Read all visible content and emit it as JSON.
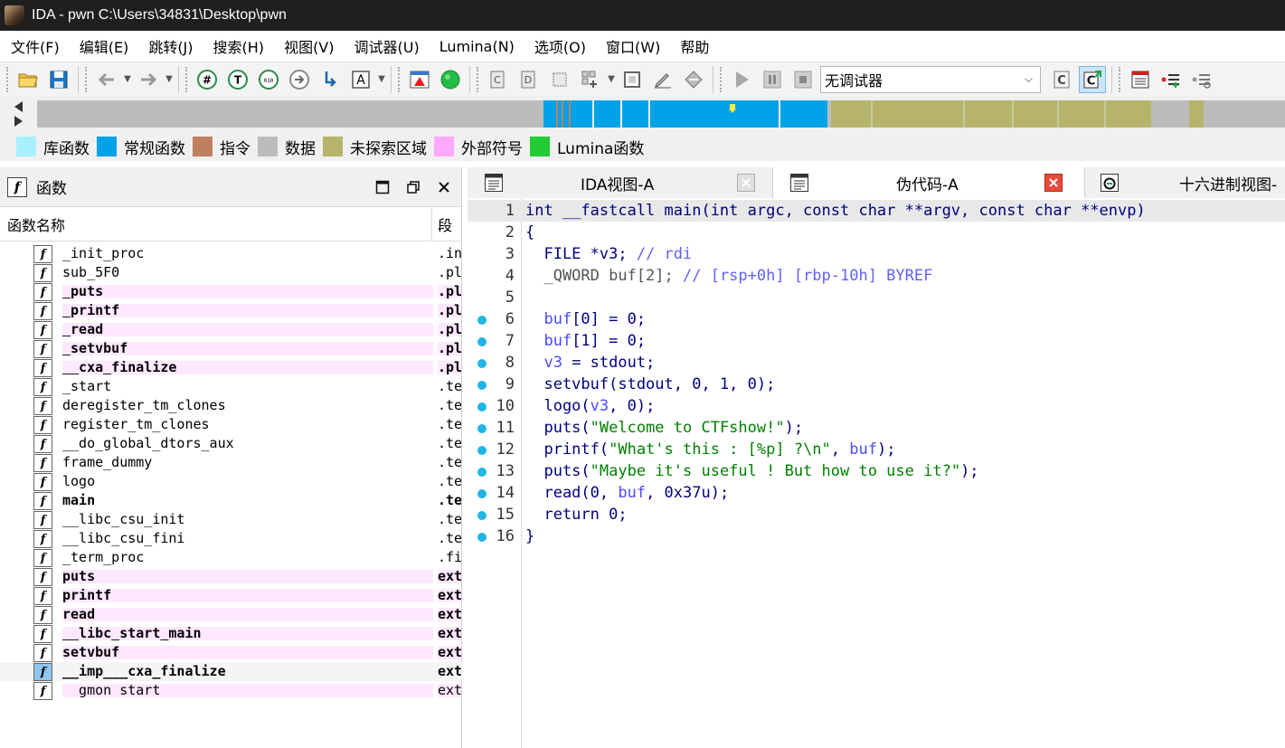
{
  "window": {
    "title": "IDA - pwn C:\\Users\\34831\\Desktop\\pwn"
  },
  "menu": [
    "文件(F)",
    "编辑(E)",
    "跳转(J)",
    "搜索(H)",
    "视图(V)",
    "调试器(U)",
    "Lumina(N)",
    "选项(O)",
    "窗口(W)",
    "帮助"
  ],
  "toolbar": {
    "debugger_select": "无调试器"
  },
  "legend": [
    {
      "label": "库函数",
      "color": "#a8f0ff"
    },
    {
      "label": "常规函数",
      "color": "#00a2e8"
    },
    {
      "label": "指令",
      "color": "#c08060"
    },
    {
      "label": "数据",
      "color": "#bcbcbc"
    },
    {
      "label": "未探索区域",
      "color": "#b6b46a"
    },
    {
      "label": "外部符号",
      "color": "#ffa8ff"
    },
    {
      "label": "Lumina函数",
      "color": "#22cc33"
    }
  ],
  "functions_panel": {
    "title": "函数",
    "col_name": "函数名称",
    "col_segment": "段",
    "rows": [
      {
        "name": "_init_proc",
        "seg": ".init",
        "ext": false,
        "bold": false
      },
      {
        "name": "sub_5F0",
        "seg": ".plt",
        "ext": false,
        "bold": false
      },
      {
        "name": "_puts",
        "seg": ".plt",
        "ext": true,
        "bold": true
      },
      {
        "name": "_printf",
        "seg": ".plt",
        "ext": true,
        "bold": true
      },
      {
        "name": "_read",
        "seg": ".plt",
        "ext": true,
        "bold": true
      },
      {
        "name": "_setvbuf",
        "seg": ".plt",
        "ext": true,
        "bold": true
      },
      {
        "name": "__cxa_finalize",
        "seg": ".plt",
        "ext": true,
        "bold": true
      },
      {
        "name": "_start",
        "seg": ".text",
        "ext": false,
        "bold": false
      },
      {
        "name": "deregister_tm_clones",
        "seg": ".text",
        "ext": false,
        "bold": false
      },
      {
        "name": "register_tm_clones",
        "seg": ".text",
        "ext": false,
        "bold": false
      },
      {
        "name": "__do_global_dtors_aux",
        "seg": ".text",
        "ext": false,
        "bold": false
      },
      {
        "name": "frame_dummy",
        "seg": ".text",
        "ext": false,
        "bold": false
      },
      {
        "name": "logo",
        "seg": ".text",
        "ext": false,
        "bold": false
      },
      {
        "name": "main",
        "seg": ".text",
        "ext": false,
        "bold": true
      },
      {
        "name": "__libc_csu_init",
        "seg": ".text",
        "ext": false,
        "bold": false
      },
      {
        "name": "__libc_csu_fini",
        "seg": ".text",
        "ext": false,
        "bold": false
      },
      {
        "name": "_term_proc",
        "seg": ".fini",
        "ext": false,
        "bold": false
      },
      {
        "name": "puts",
        "seg": "extern",
        "ext": true,
        "bold": true
      },
      {
        "name": "printf",
        "seg": "extern",
        "ext": true,
        "bold": true
      },
      {
        "name": "read",
        "seg": "extern",
        "ext": true,
        "bold": true
      },
      {
        "name": "__libc_start_main",
        "seg": "extern",
        "ext": true,
        "bold": true
      },
      {
        "name": "setvbuf",
        "seg": "extern",
        "ext": true,
        "bold": true
      },
      {
        "name": "__imp___cxa_finalize",
        "seg": "extern",
        "ext": false,
        "bold": true,
        "selected": true
      },
      {
        "name": "__gmon_start__",
        "seg": "extern",
        "ext": true,
        "bold": false
      }
    ]
  },
  "tabs": [
    {
      "label": "IDA视图-A",
      "active": false
    },
    {
      "label": "伪代码-A",
      "active": true
    },
    {
      "label": "十六进制视图-",
      "active": false
    }
  ],
  "code": [
    {
      "ln": "1",
      "dot": false,
      "hl": true,
      "parts": [
        [
          "c",
          "int __fastcall main(int argc, const char **argv, const char **envp)"
        ]
      ]
    },
    {
      "ln": "2",
      "dot": false,
      "hl": false,
      "parts": [
        [
          "c",
          "{"
        ]
      ]
    },
    {
      "ln": "3",
      "dot": false,
      "hl": false,
      "parts": [
        [
          "c",
          "  FILE *v3; "
        ],
        [
          "cm",
          "// rdi"
        ]
      ]
    },
    {
      "ln": "4",
      "dot": false,
      "hl": false,
      "parts": [
        [
          "g",
          "  _QWORD buf[2]; "
        ],
        [
          "cm",
          "// [rsp+0h] [rbp-10h] BYREF"
        ]
      ]
    },
    {
      "ln": "5",
      "dot": false,
      "hl": false,
      "parts": [
        [
          "c",
          ""
        ]
      ]
    },
    {
      "ln": "6",
      "dot": true,
      "hl": false,
      "parts": [
        [
          "v",
          "  buf"
        ],
        [
          "c",
          "[0] = 0;"
        ]
      ]
    },
    {
      "ln": "7",
      "dot": true,
      "hl": false,
      "parts": [
        [
          "v",
          "  buf"
        ],
        [
          "c",
          "[1] = 0;"
        ]
      ]
    },
    {
      "ln": "8",
      "dot": true,
      "hl": false,
      "parts": [
        [
          "v",
          "  v3"
        ],
        [
          "c",
          " = stdout;"
        ]
      ]
    },
    {
      "ln": "9",
      "dot": true,
      "hl": false,
      "parts": [
        [
          "c",
          "  setvbuf(stdout, 0, 1, 0);"
        ]
      ]
    },
    {
      "ln": "10",
      "dot": true,
      "hl": false,
      "parts": [
        [
          "c",
          "  logo("
        ],
        [
          "v",
          "v3"
        ],
        [
          "c",
          ", 0);"
        ]
      ]
    },
    {
      "ln": "11",
      "dot": true,
      "hl": false,
      "parts": [
        [
          "c",
          "  puts("
        ],
        [
          "s",
          "\"Welcome to CTFshow!\""
        ],
        [
          "c",
          ");"
        ]
      ]
    },
    {
      "ln": "12",
      "dot": true,
      "hl": false,
      "parts": [
        [
          "c",
          "  printf("
        ],
        [
          "s",
          "\"What's this : [%p] ?\\n\""
        ],
        [
          "c",
          ", "
        ],
        [
          "v",
          "buf"
        ],
        [
          "c",
          ");"
        ]
      ]
    },
    {
      "ln": "13",
      "dot": true,
      "hl": false,
      "parts": [
        [
          "c",
          "  puts("
        ],
        [
          "s",
          "\"Maybe it's useful ! But how to use it?\""
        ],
        [
          "c",
          ");"
        ]
      ]
    },
    {
      "ln": "14",
      "dot": true,
      "hl": false,
      "parts": [
        [
          "c",
          "  read(0, "
        ],
        [
          "v",
          "buf"
        ],
        [
          "c",
          ", 0x37u);"
        ]
      ]
    },
    {
      "ln": "15",
      "dot": true,
      "hl": false,
      "parts": [
        [
          "c",
          "  return 0;"
        ]
      ]
    },
    {
      "ln": "16",
      "dot": true,
      "hl": false,
      "parts": [
        [
          "c",
          "}"
        ]
      ]
    }
  ]
}
